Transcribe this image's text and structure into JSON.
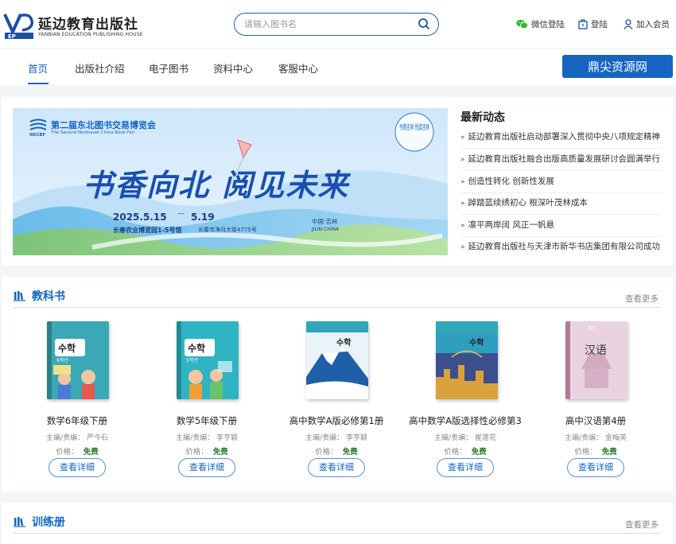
{
  "header": {
    "logo_cn": "延边教育出版社",
    "logo_en": "YANBIAN EDUCATION PUBLISHING HOUSE",
    "logo_mark": "EP",
    "search_placeholder": "请输入图书名",
    "wechat_login": "微信登陆",
    "login": "登陆",
    "join": "加入会员"
  },
  "nav": {
    "items": [
      "首页",
      "出版社介绍",
      "电子图书",
      "资料中心",
      "客服中心"
    ],
    "active_index": 0,
    "resource_button": "鼎尖资源网"
  },
  "banner": {
    "fair_name": "第二届东北图书交易博览会",
    "fair_en": "The Second Northeast China Book Fair",
    "fair_abbr": "NECBF",
    "slogan": "书香向北 阅见未来",
    "date": "2025.5.15",
    "date_end": "5.19",
    "venue": "长春农业博览园1-5号馆",
    "address": "长春市净月大街4775号",
    "location_cn": "中国·吉林",
    "location_en": "JILIN CHINA",
    "seal": "书香吉林 悦读吉林"
  },
  "news": {
    "title": "最新动态",
    "items": [
      "延边教育出版社启动部署深入贯彻中央八项规定精神",
      "延边教育出版社融合出版高质量发展研讨会圆满举行",
      "创造性转化 创新性发展",
      "踔踏蓝续绣初心 根深叶茂林成本",
      "凛平两岸阔 风正一帆悬",
      "延边教育出版社与天津市新华书店集团有限公司成功"
    ]
  },
  "textbooks": {
    "title": "教科书",
    "more": "查看更多",
    "books": [
      {
        "name": "数学6年级下册",
        "editor_label": "主编/责编：",
        "editor": "严今石",
        "price_label": "价格：",
        "price": "免费",
        "button": "查看详细",
        "cover_title": "수학",
        "cover_sub": "6학년"
      },
      {
        "name": "数学5年级下册",
        "editor_label": "主编/责编：",
        "editor": "李亨颖",
        "price_label": "价格：",
        "price": "免费",
        "button": "查看详细",
        "cover_title": "수학",
        "cover_sub": "5학년"
      },
      {
        "name": "高中数学A版必修第1册",
        "editor_label": "主编/责编：",
        "editor": "李亨颖",
        "price_label": "价格：",
        "price": "免费",
        "button": "查看详细",
        "cover_title": "수학",
        "cover_sub": ""
      },
      {
        "name": "高中数学A版选择性必修第3",
        "editor_label": "主编/责编：",
        "editor": "崔莲花",
        "price_label": "价格：",
        "price": "免费",
        "button": "查看详细",
        "cover_title": "수학",
        "cover_sub": ""
      },
      {
        "name": "高中汉语第4册",
        "editor_label": "主编/责编：",
        "editor": "金梅英",
        "price_label": "价格：",
        "price": "免费",
        "button": "查看详细",
        "cover_title": "汉语",
        "cover_sub": "高中"
      }
    ]
  },
  "workbooks": {
    "title": "训练册",
    "more": "查看更多"
  },
  "colors": {
    "brand_blue": "#1565c0",
    "free_green": "#2e7d32"
  }
}
